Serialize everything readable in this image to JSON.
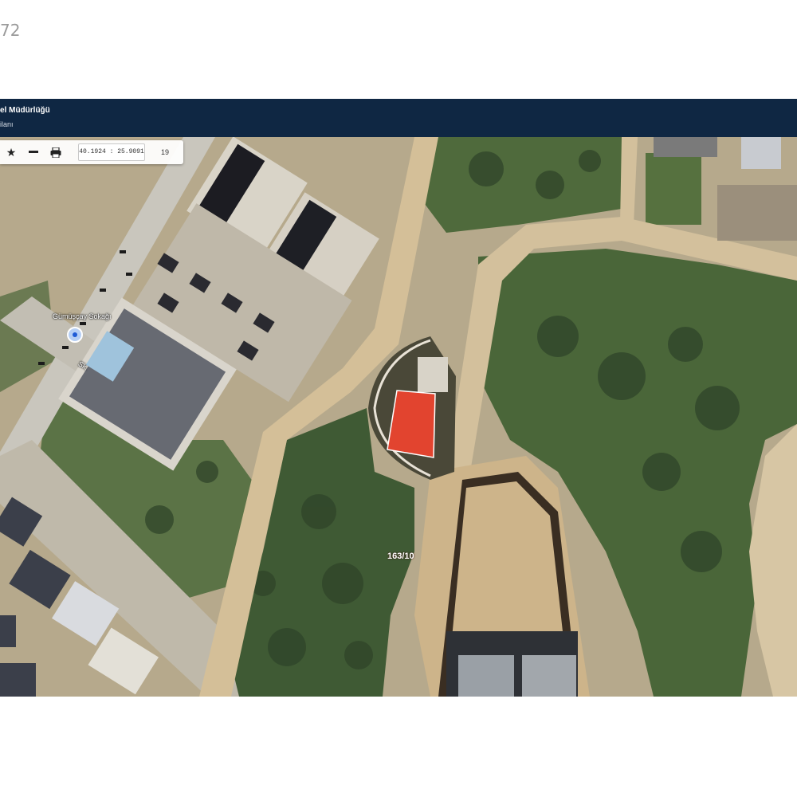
{
  "page": {
    "counter": "72"
  },
  "app": {
    "title": "el Müdürlüğü",
    "subtitle": "ilanı"
  },
  "toolbar": {
    "star_icon": "star-icon",
    "minus_icon": "minus-icon",
    "print_icon": "printer-icon",
    "coordinates": "40.1924 : 25.9091",
    "zoom_level": "19"
  },
  "map": {
    "street_label": "Gümüşçay Sokağı",
    "road_label": "Sk.",
    "parcel_label": "163/10",
    "colors": {
      "header": "#0f2743",
      "parcel_fill": "#e2442f",
      "vegetation": "#4d6a3c",
      "dirt_road": "#cbb38e"
    }
  }
}
